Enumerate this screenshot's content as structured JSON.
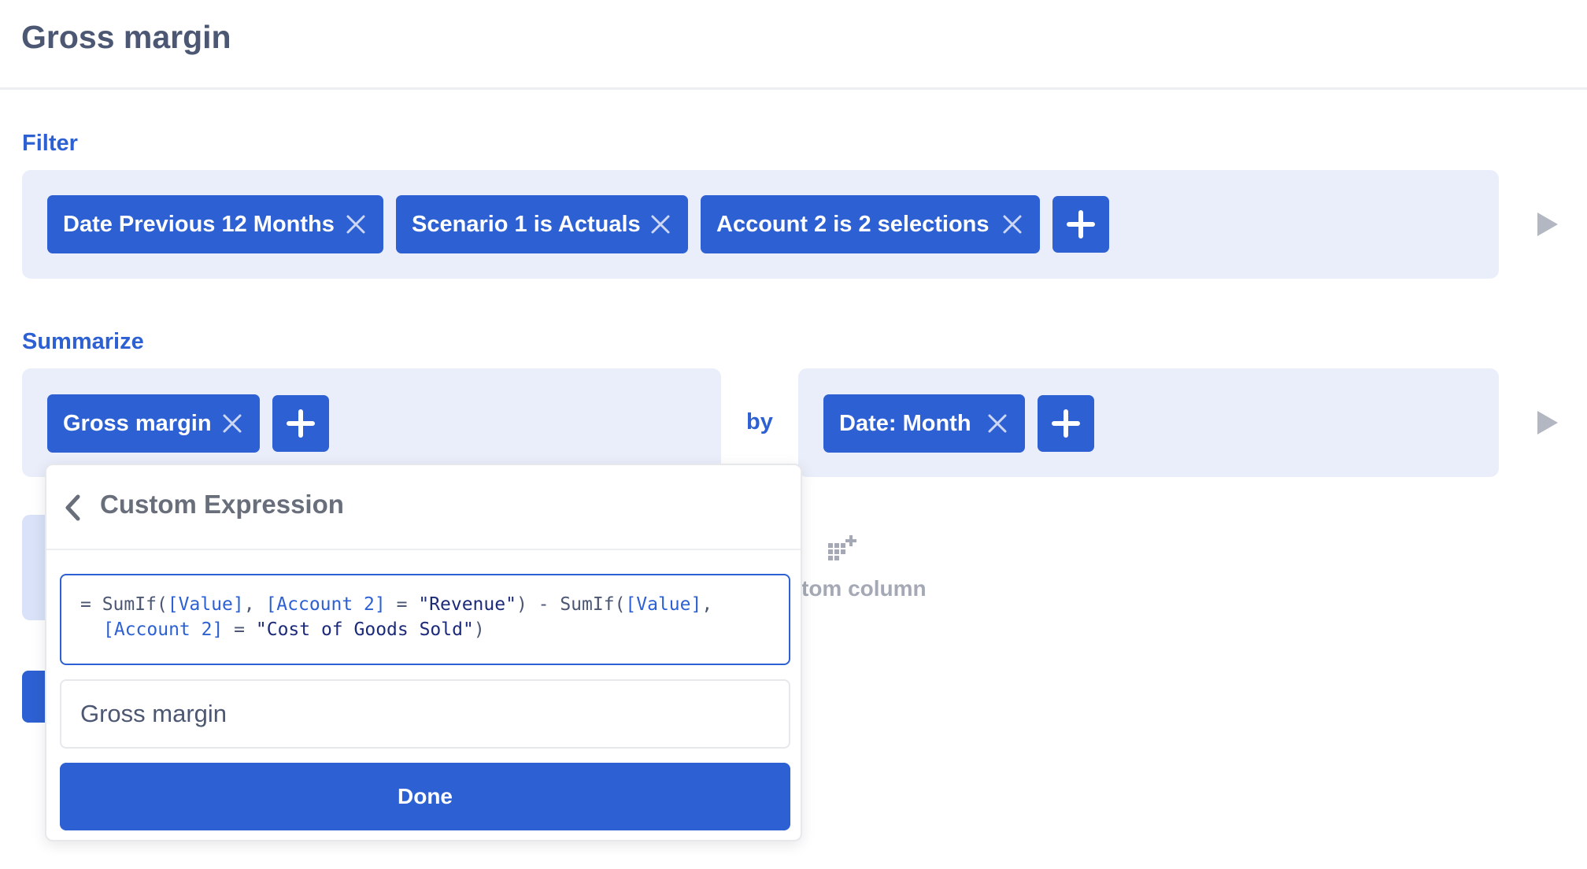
{
  "header": {
    "title": "Gross margin"
  },
  "filter": {
    "label": "Filter",
    "pills": [
      {
        "label": "Date Previous 12 Months"
      },
      {
        "label": "Scenario 1 is Actuals"
      },
      {
        "label": "Account 2 is 2 selections"
      }
    ]
  },
  "summarize": {
    "label": "Summarize",
    "metrics": [
      {
        "label": "Gross margin"
      }
    ],
    "by_label": "by",
    "groups": [
      {
        "label": "Date: Month"
      }
    ]
  },
  "custom_column": {
    "label": "tom column"
  },
  "popover": {
    "title": "Custom Expression",
    "expression": {
      "line1": {
        "eq": "= ",
        "fn1": "SumIf(",
        "f1": "[Value]",
        "c1": ", ",
        "f2": "[Account 2]",
        "op1": " = ",
        "s1": "\"Revenue\"",
        "p1": ") - ",
        "fn2": "SumIf(",
        "f3": "[Value]",
        "c2": ","
      },
      "line2": {
        "f4": "[Account 2]",
        "op2": " = ",
        "s2": "\"Cost of Goods Sold\"",
        "p2": ")"
      }
    },
    "name_value": "Gross margin",
    "done_label": "Done"
  },
  "colors": {
    "accent": "#2d60d2",
    "panel": "#eaeefb",
    "text": "#4c5773"
  }
}
